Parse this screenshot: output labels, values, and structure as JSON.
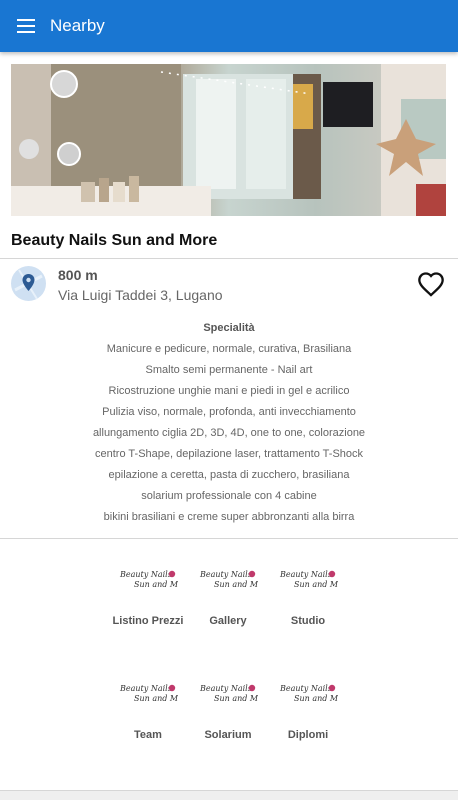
{
  "appbar": {
    "title": "Nearby",
    "menu_icon": "menu-icon",
    "color": "#1976d2"
  },
  "shop": {
    "name": "Beauty Nails Sun and More",
    "distance": "800 m",
    "address": "Via Luigi Taddei 3, Lugano"
  },
  "specialties": {
    "title": "Specialità",
    "lines": [
      "Manicure e pedicure, normale, curativa, Brasiliana",
      "Smalto semi permanente - Nail art",
      "Ricostruzione unghie mani e piedi in gel e acrilico",
      "Pulizia viso, normale, profonda, anti invecchiamento",
      "allungamento ciglia 2D, 3D, 4D,  one to one, colorazione",
      "centro T-Shape, depilazione laser, trattamento T-Shock",
      "epilazione a ceretta, pasta di zucchero, brasiliana",
      "solarium professionale con 4 cabine",
      "bikini brasiliani e creme super abbronzanti alla birra"
    ]
  },
  "sections": [
    {
      "label": "Listino Prezzi"
    },
    {
      "label": "Gallery"
    },
    {
      "label": "Studio"
    },
    {
      "label": "Team"
    },
    {
      "label": "Solarium"
    },
    {
      "label": "Diplomi"
    }
  ],
  "logo": {
    "line1": "Beauty Nails",
    "line2": "Sun and More"
  }
}
